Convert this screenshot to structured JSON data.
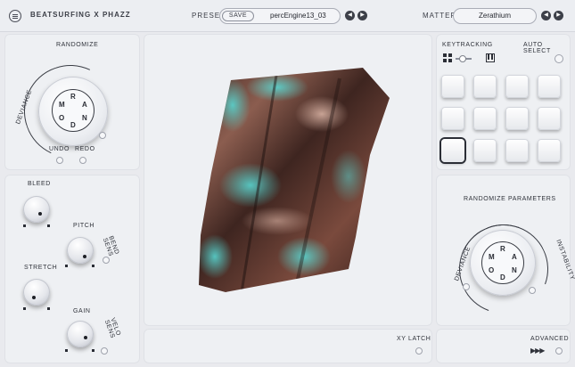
{
  "header": {
    "brand": "BEATSURFING X PHAZZ",
    "preset_label": "PRESET",
    "save_label": "SAVE",
    "preset_name": "percEngine13_03",
    "matter_label": "MATTER",
    "matter_name": "Zerathium",
    "prev_symbol": "◀",
    "next_symbol": "▶"
  },
  "randomize": {
    "title": "RANDOMIZE",
    "deviance_label": "DEVIANCE",
    "undo_label": "UNDO",
    "redo_label": "REDO",
    "dial_letters": [
      "R",
      "A",
      "N",
      "D",
      "O",
      "M"
    ]
  },
  "knobs": {
    "bleed": "BLEED",
    "pitch": "PITCH",
    "bend_sens": "BEND SENS",
    "stretch": "STRETCH",
    "gain": "GAIN",
    "velo_sens": "VELO SENS"
  },
  "keytracking": {
    "title": "KEYTRACKING",
    "auto_select": "AUTO SELECT",
    "grid_icon": "grid-icon",
    "piano_icon": "piano-keys-icon",
    "pads": 12,
    "selected_pad": 8
  },
  "randomize_params": {
    "title": "RANDOMIZE PARAMETERS",
    "deviance_label": "DEVIANCE",
    "instability_label": "INSTABILITY",
    "dial_letters": [
      "R",
      "A",
      "N",
      "D",
      "O",
      "M"
    ]
  },
  "footer": {
    "xy_latch": "XY LATCH",
    "advanced": "ADVANCED",
    "advanced_arrows": "▶▶▶"
  },
  "colors": {
    "background": "#e9eaee",
    "panel": "#eef0f3",
    "text": "#2b2e36",
    "accent_teal": "#3fb5b0",
    "accent_copper": "#b06a55"
  }
}
